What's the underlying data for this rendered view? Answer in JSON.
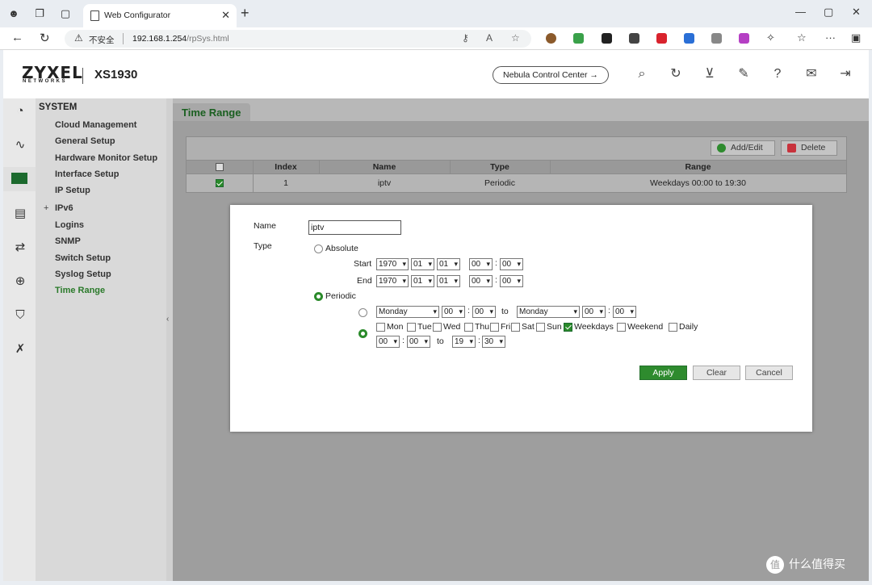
{
  "browser": {
    "tab_title": "Web Configurator",
    "insecure_label": "不安全",
    "url_host": "192.168.1.254",
    "url_path": "/rpSys.html"
  },
  "header": {
    "brand": "ZYXEL",
    "brand_sub": "NETWORKS",
    "model": "XS1930",
    "nebula_label": "Nebula Control Center →"
  },
  "sidebar": {
    "section": "SYSTEM",
    "items": [
      {
        "label": "Cloud Management"
      },
      {
        "label": "General Setup"
      },
      {
        "label": "Hardware Monitor Setup"
      },
      {
        "label": "Interface Setup"
      },
      {
        "label": "IP Setup"
      },
      {
        "label": "IPv6"
      },
      {
        "label": "Logins"
      },
      {
        "label": "SNMP"
      },
      {
        "label": "Switch Setup"
      },
      {
        "label": "Syslog Setup"
      },
      {
        "label": "Time Range"
      }
    ],
    "expand_symbol": "+",
    "active": "Time Range"
  },
  "page": {
    "title": "Time Range",
    "add_edit_label": "Add/Edit",
    "delete_label": "Delete",
    "columns": [
      "Index",
      "Name",
      "Type",
      "Range"
    ],
    "rows": [
      {
        "index": "1",
        "name": "iptv",
        "type": "Periodic",
        "range": "Weekdays 00:00 to 19:30",
        "checked": true
      }
    ]
  },
  "dialog": {
    "name_label": "Name",
    "name_value": "iptv",
    "type_label": "Type",
    "absolute_label": "Absolute",
    "start_label": "Start",
    "end_label": "End",
    "start": {
      "year": "1970",
      "month": "01",
      "day": "01",
      "hour": "00",
      "minute": "00"
    },
    "end": {
      "year": "1970",
      "month": "01",
      "day": "01",
      "hour": "00",
      "minute": "00"
    },
    "periodic_label": "Periodic",
    "periodic_mode": "days",
    "range_from_day": "Monday",
    "range_from_hour": "00",
    "range_from_minute": "00",
    "to_label": "to",
    "range_to_day": "Monday",
    "range_to_hour": "00",
    "range_to_minute": "00",
    "days": [
      {
        "label": "Mon",
        "checked": false
      },
      {
        "label": "Tue",
        "checked": false
      },
      {
        "label": "Wed",
        "checked": false
      },
      {
        "label": "Thu",
        "checked": false
      },
      {
        "label": "Fri",
        "checked": false
      },
      {
        "label": "Sat",
        "checked": false
      },
      {
        "label": "Sun",
        "checked": false
      },
      {
        "label": "Weekdays",
        "checked": true
      },
      {
        "label": "Weekend",
        "checked": false
      },
      {
        "label": "Daily",
        "checked": false
      }
    ],
    "days_from_hour": "00",
    "days_from_minute": "00",
    "days_to_hour": "19",
    "days_to_minute": "30",
    "colon": ":",
    "apply_label": "Apply",
    "clear_label": "Clear",
    "cancel_label": "Cancel"
  },
  "watermark": "什么值得买",
  "colors": {
    "accent_green": "#2e8b2e",
    "title_green": "#1a5f20"
  }
}
